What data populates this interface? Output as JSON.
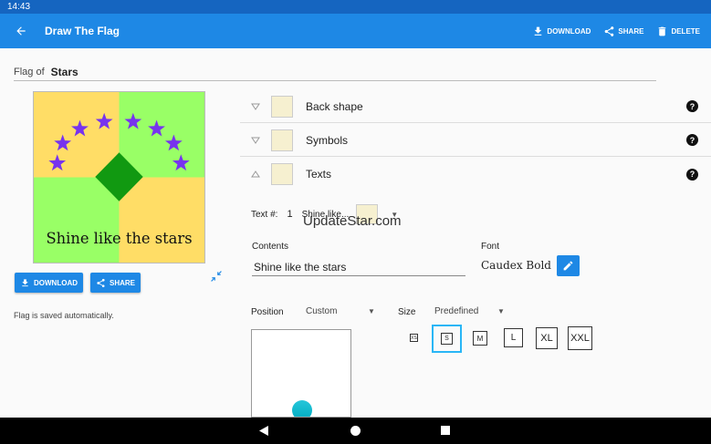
{
  "status": {
    "time": "14:43"
  },
  "appbar": {
    "title": "Draw The Flag",
    "actions": [
      {
        "label": "DOWNLOAD",
        "icon": "download-icon"
      },
      {
        "label": "SHARE",
        "icon": "share-icon"
      },
      {
        "label": "DELETE",
        "icon": "delete-icon"
      }
    ]
  },
  "flag_of": {
    "label": "Flag of",
    "value": "Stars"
  },
  "flag_preview": {
    "text": "Shine like the stars",
    "colors": {
      "yellow": "#ffdd66",
      "green": "#99ff66",
      "diamond": "#119911",
      "star": "#7733ee"
    }
  },
  "left_buttons": {
    "download": "DOWNLOAD",
    "share": "SHARE"
  },
  "autosave_note": "Flag is saved automatically.",
  "panels": [
    {
      "title": "Back shape",
      "expanded": false
    },
    {
      "title": "Symbols",
      "expanded": false
    },
    {
      "title": "Texts",
      "expanded": true
    }
  ],
  "texts_section": {
    "text_label": "Text #:",
    "text_number": "1",
    "selected_text": "Shine like...",
    "watermark": "UpdateStar.com",
    "contents_label": "Contents",
    "contents_value": "Shine like the stars",
    "font_label": "Font",
    "font_value": "Caudex Bold",
    "position_label": "Position",
    "position_value": "Custom",
    "size_label": "Size",
    "size_value": "Predefined",
    "sizes": [
      "XS",
      "S",
      "M",
      "L",
      "XL",
      "XXL"
    ],
    "selected_size": "S"
  },
  "accent": "#1e88e5"
}
